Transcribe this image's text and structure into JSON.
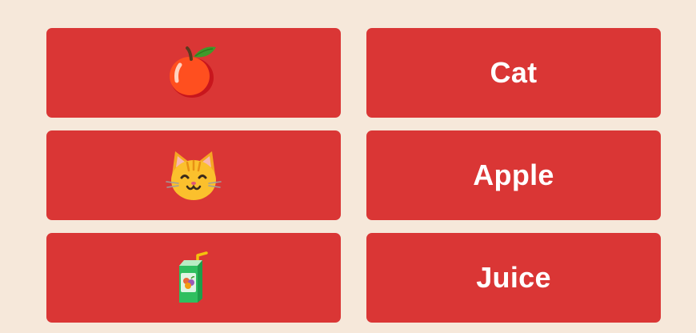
{
  "colors": {
    "background": "#f6e8da",
    "card": "#da3635",
    "text": "#ffffff"
  },
  "pictures": [
    {
      "icon": "apple-icon"
    },
    {
      "icon": "cat-face-icon"
    },
    {
      "icon": "juice-box-icon"
    }
  ],
  "words": [
    {
      "label": "Cat"
    },
    {
      "label": "Apple"
    },
    {
      "label": "Juice"
    }
  ]
}
